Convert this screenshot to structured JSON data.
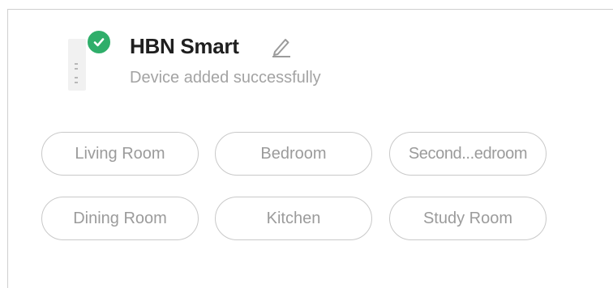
{
  "device": {
    "name": "HBN Smart",
    "status": "Device added successfully"
  },
  "rooms": [
    "Living Room",
    "Bedroom",
    "Second...edroom",
    "Dining Room",
    "Kitchen",
    "Study Room"
  ],
  "colors": {
    "success": "#2fae6a",
    "chip_border": "#c9c9c9",
    "chip_text": "#9b9b9b"
  },
  "icons": {
    "device": "smart-plug-icon",
    "success": "check-circle-icon",
    "edit": "pencil-icon"
  }
}
